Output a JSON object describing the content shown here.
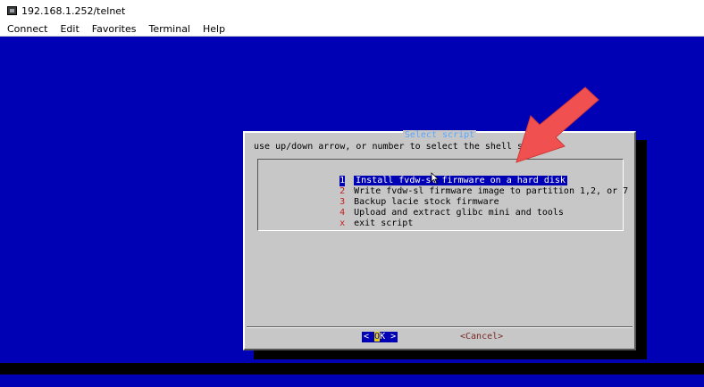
{
  "window": {
    "title": "192.168.1.252/telnet"
  },
  "menubar": {
    "items": [
      "Connect",
      "Edit",
      "Favorites",
      "Terminal",
      "Help"
    ]
  },
  "dialog": {
    "title": "Select script",
    "prompt": "use up/down arrow, or number to select the shell script",
    "options": [
      {
        "tag": "1",
        "label": "Install fvdw-sl firmware on a hard disk",
        "selected": true
      },
      {
        "tag": "2",
        "label": "Write fvdw-sl firmware image to partition 1,2, or 7",
        "selected": false
      },
      {
        "tag": "3",
        "label": "Backup lacie stock firmware",
        "selected": false
      },
      {
        "tag": "4",
        "label": "Upload and extract glibc mini and tools",
        "selected": false
      },
      {
        "tag": "x",
        "label": "exit script",
        "selected": false
      }
    ],
    "ok": {
      "left": "< ",
      "hot": "O",
      "rest": "K",
      "right": " >"
    },
    "cancel_label": "<Cancel>"
  },
  "colors": {
    "terminal_bg": "#0000b4",
    "dialog_bg": "#c7c7c7",
    "highlight": "#0000b4",
    "title_color": "#5aa8ff",
    "tag_color": "#c81e1e",
    "annotation_arrow": "#f05050"
  },
  "icons": {
    "window": "terminal-app-icon",
    "annotation": "red-arrow-icon",
    "cursor": "mouse-pointer-icon"
  }
}
